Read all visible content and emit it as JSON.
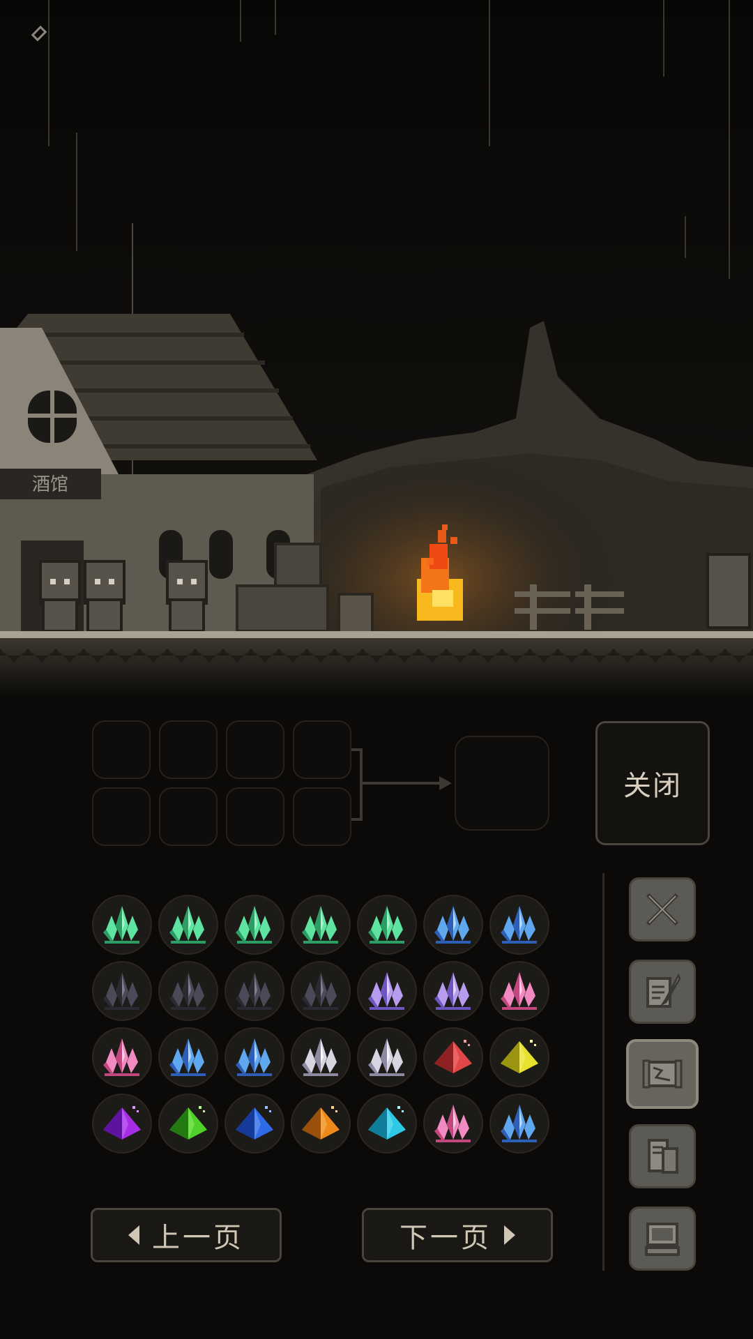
{
  "scene": {
    "sign_text": "酒馆",
    "description_icon": "settings-ring-icon"
  },
  "crafting": {
    "input_slot_count": 8,
    "close_label": "关闭"
  },
  "inventory": {
    "rows": [
      [
        "crystal-green",
        "crystal-green",
        "crystal-green",
        "crystal-green",
        "crystal-green",
        "crystal-blue",
        "crystal-blue"
      ],
      [
        "crystal-dark",
        "crystal-dark",
        "crystal-dark",
        "crystal-dark",
        "crystal-violet",
        "crystal-violet",
        "crystal-pink"
      ],
      [
        "crystal-pink",
        "crystal-blue",
        "crystal-blue",
        "crystal-white",
        "crystal-white",
        "pyramid-red",
        "pyramid-yellow"
      ],
      [
        "pyramid-purple",
        "pyramid-green",
        "pyramid-blue",
        "pyramid-orange",
        "pyramid-cyan",
        "crystal-pink",
        "crystal-blue"
      ]
    ],
    "colors": {
      "crystal-green": [
        "#5ee3a0",
        "#2c9e63",
        "#bff5d6"
      ],
      "crystal-blue": [
        "#5fa8f0",
        "#2d5fb8",
        "#cfe6ff"
      ],
      "crystal-dark": [
        "#4a4a58",
        "#2a2a33",
        "#8b8b9e"
      ],
      "crystal-violet": [
        "#b79cf0",
        "#6e56c2",
        "#efe4ff"
      ],
      "crystal-pink": [
        "#f28ac2",
        "#c2477f",
        "#ffe0f0"
      ],
      "crystal-white": [
        "#d9d4e2",
        "#8f88a3",
        "#ffffff"
      ],
      "pyramid-red": [
        "#e04848",
        "#8e2222",
        "#ff9a9a"
      ],
      "pyramid-yellow": [
        "#e6e22e",
        "#9a9410",
        "#fffaa0"
      ],
      "pyramid-purple": [
        "#a72ee6",
        "#5e12a0",
        "#e09aff"
      ],
      "pyramid-green": [
        "#4fd12a",
        "#237a12",
        "#b5ff8a"
      ],
      "pyramid-blue": [
        "#2f6be6",
        "#163a9a",
        "#9ac2ff"
      ],
      "pyramid-orange": [
        "#ee8a1c",
        "#9a4f0a",
        "#ffd08a"
      ],
      "pyramid-cyan": [
        "#2ec9e6",
        "#107e9a",
        "#a0f4ff"
      ]
    }
  },
  "side_tabs": [
    "sword-icon",
    "scroll-quill-icon",
    "map-scroll-icon",
    "documents-icon",
    "computer-icon"
  ],
  "pagination": {
    "prev_label": "上一页",
    "next_label": "下一页"
  }
}
